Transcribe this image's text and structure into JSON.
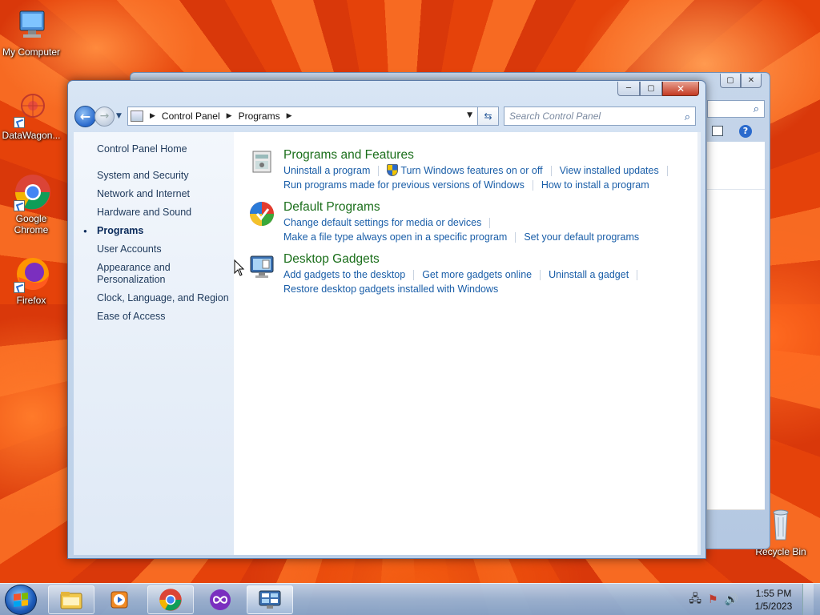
{
  "desktop": {
    "icons": [
      {
        "label": "My Computer"
      },
      {
        "label": "DataWagon..."
      },
      {
        "label": "Google Chrome"
      },
      {
        "label": "Firefox"
      },
      {
        "label": "Recycle Bin"
      }
    ]
  },
  "window": {
    "caption": {
      "minimize": "─",
      "maximize": "▢",
      "close": "✕"
    },
    "address": {
      "crumbs": [
        "Control Panel",
        "Programs"
      ]
    },
    "search": {
      "placeholder": "Search Control Panel"
    },
    "left_nav": {
      "home": "Control Panel Home",
      "categories": [
        {
          "label": "System and Security"
        },
        {
          "label": "Network and Internet"
        },
        {
          "label": "Hardware and Sound"
        },
        {
          "label": "Programs",
          "active": true
        },
        {
          "label": "User Accounts"
        },
        {
          "label": "Appearance and Personalization"
        },
        {
          "label": "Clock, Language, and Region"
        },
        {
          "label": "Ease of Access"
        }
      ]
    },
    "groups": [
      {
        "title": "Programs and Features",
        "icon": "programs-features-icon",
        "links": [
          "Uninstall a program",
          "Turn Windows features on or off",
          "View installed updates",
          "Run programs made for previous versions of Windows",
          "How to install a program"
        ]
      },
      {
        "title": "Default Programs",
        "icon": "default-programs-icon",
        "links": [
          "Change default settings for media or devices",
          "Make a file type always open in a specific program",
          "Set your default programs"
        ]
      },
      {
        "title": "Desktop Gadgets",
        "icon": "desktop-gadgets-icon",
        "links": [
          "Add gadgets to the desktop",
          "Get more gadgets online",
          "Uninstall a gadget",
          "Restore desktop gadgets installed with Windows"
        ]
      }
    ]
  },
  "taskbar": {
    "clock": {
      "time": "1:55 PM",
      "date": "1/5/2023"
    }
  },
  "colors": {
    "link": "#1a5ea8",
    "group_title": "#1a6e1a",
    "nav_text": "#1e395b"
  }
}
